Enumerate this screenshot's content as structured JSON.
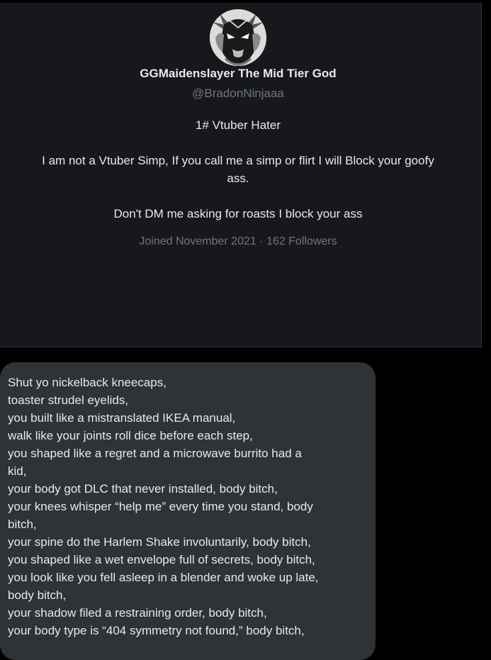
{
  "profile": {
    "display_name": "GGMaidenslayer The Mid Tier God",
    "handle": "@BradonNinjaaa",
    "bio": [
      "1# Vtuber Hater",
      "I am not a Vtuber Simp, If you call me a simp or flirt I will Block your goofy",
      "ass.",
      "Don't DM me asking for roasts I block your ass"
    ],
    "meta": "Joined November 2021 · 162 Followers"
  },
  "message": {
    "lines": [
      "Shut yo nickelback kneecaps,",
      "toaster strudel eyelids,",
      "you built like a mistranslated IKEA manual,",
      "walk like your joints roll dice before each step,",
      "you shaped like a regret and a microwave burrito had a",
      "kid,",
      "your body got DLC that never installed, body bitch,",
      "your knees whisper “help me” every time you stand, body",
      "bitch,",
      "your spine do the Harlem Shake involuntarily, body bitch,",
      "you shaped like a wet envelope full of secrets, body bitch,",
      "you look like you fell asleep in a blender and woke up late,",
      "body bitch,",
      "your shadow filed a restraining order, body bitch,",
      "your body type is “404 symmetry not found,” body bitch,"
    ]
  }
}
